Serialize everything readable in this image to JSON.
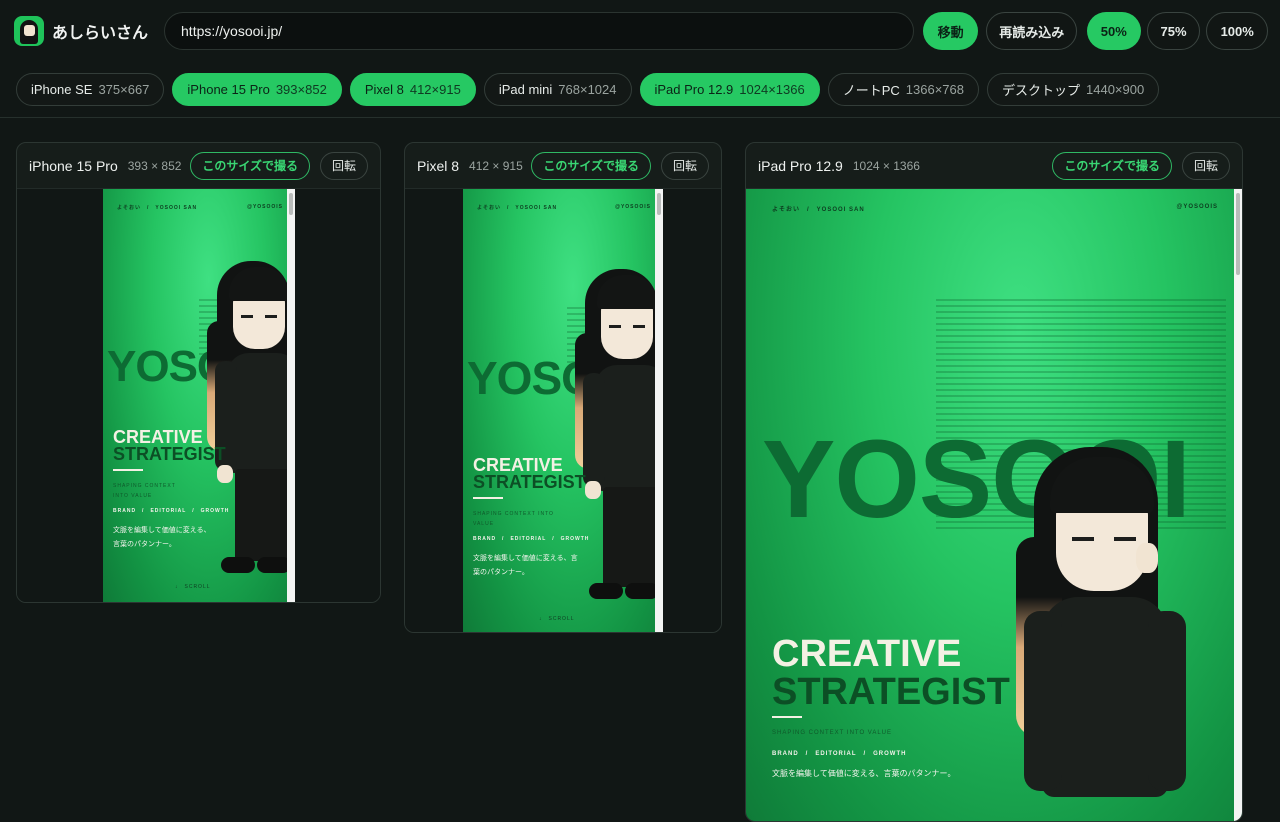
{
  "app": {
    "name": "あしらいさん"
  },
  "address_bar": {
    "url": "https://yosooi.jp/"
  },
  "toolbar": {
    "go_label": "移動",
    "reload_label": "再読み込み"
  },
  "zoom_levels": [
    {
      "label": "50%",
      "active": true
    },
    {
      "label": "75%",
      "active": false
    },
    {
      "label": "100%",
      "active": false
    }
  ],
  "devices": [
    {
      "name": "iPhone SE",
      "size": "375×667",
      "active": false
    },
    {
      "name": "iPhone 15 Pro",
      "size": "393×852",
      "active": true
    },
    {
      "name": "Pixel 8",
      "size": "412×915",
      "active": true
    },
    {
      "name": "iPad mini",
      "size": "768×1024",
      "active": false
    },
    {
      "name": "iPad Pro 12.9",
      "size": "1024×1366",
      "active": true
    },
    {
      "name": "ノートPC",
      "size": "1366×768",
      "active": false
    },
    {
      "name": "デスクトップ",
      "size": "1440×900",
      "active": false
    }
  ],
  "panels": [
    {
      "name": "iPhone 15 Pro",
      "size": "393 × 852",
      "shoot_label": "このサイズで撮る",
      "rotate_label": "回転"
    },
    {
      "name": "Pixel 8",
      "size": "412 × 915",
      "shoot_label": "このサイズで撮る",
      "rotate_label": "回転"
    },
    {
      "name": "iPad Pro 12.9",
      "size": "1024 × 1366",
      "shoot_label": "このサイズで撮る",
      "rotate_label": "回転"
    }
  ],
  "site": {
    "nav_left": "よそおい　/　YOSOOI SAN",
    "nav_right": "@YOSOOIS",
    "headline": "YOSOOI",
    "creative": "CREATIVE",
    "strategist": "STRATEGIST",
    "tagline": "SHAPING CONTEXT INTO VALUE",
    "tags": "BRAND　/　EDITORIAL　/　GROWTH",
    "copy_line1": "文脈を編集して価値に変える、",
    "copy_line2": "言葉のパタンナー。",
    "copy_full": "文脈を編集して価値に変える、言葉のパタンナー。",
    "copy_pixel1": "文脈を編集して価値に変える、言",
    "copy_pixel2": "葉のパタンナー。",
    "scroll": "↓　SCROLL",
    "brand_green": "#26c963"
  }
}
